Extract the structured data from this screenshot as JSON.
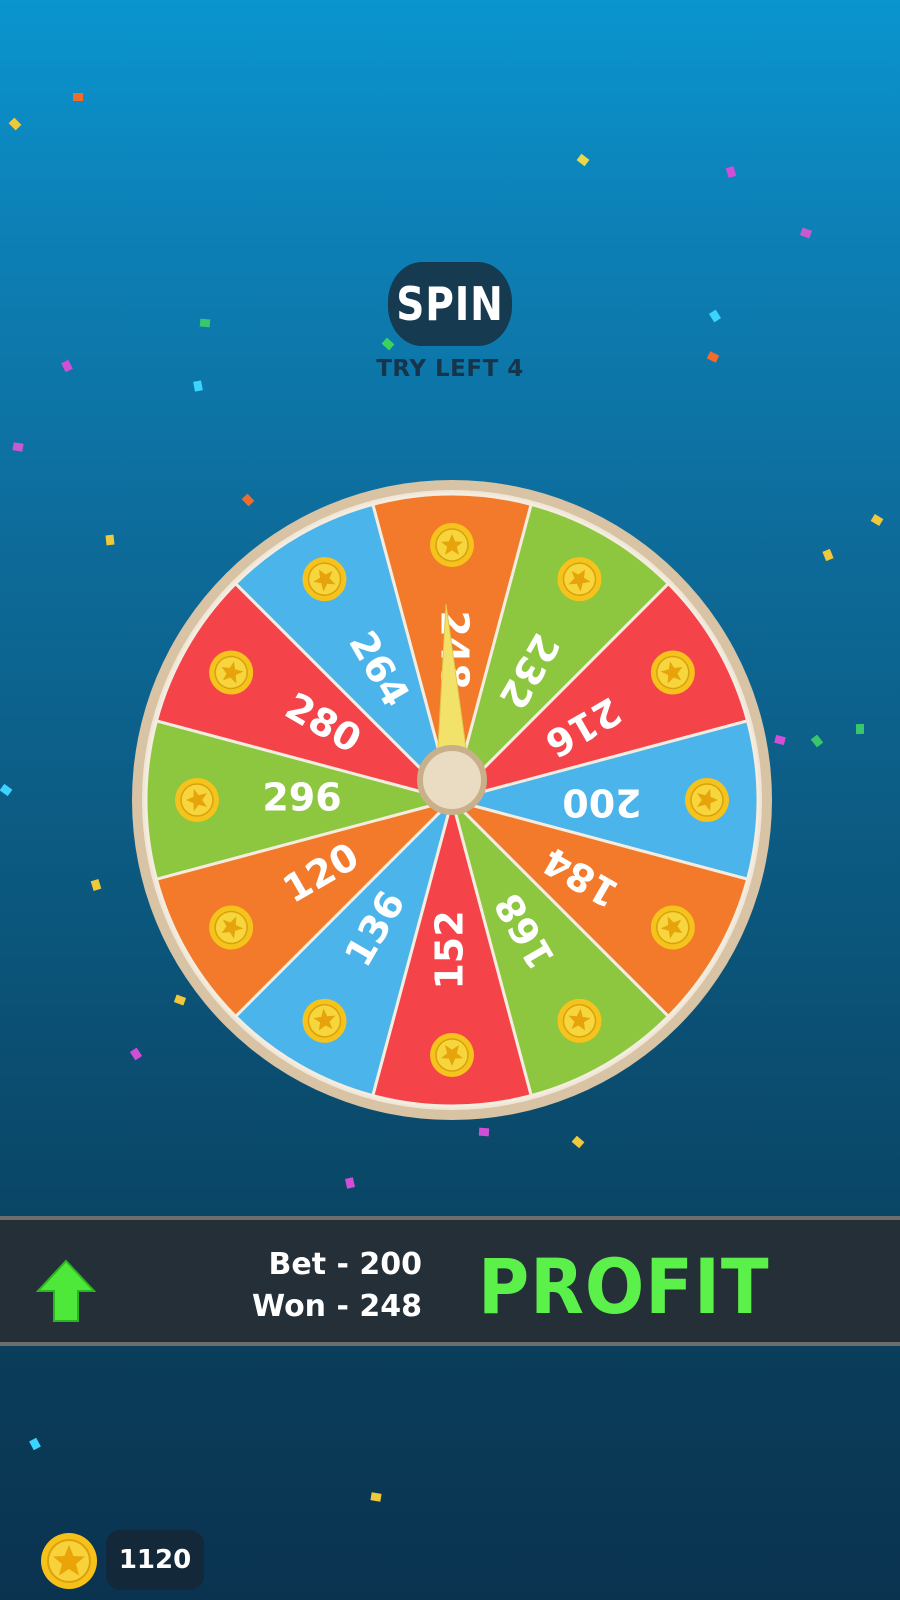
{
  "spin": {
    "label": "SPIN",
    "tries": "TRY LEFT 4"
  },
  "wheel": {
    "segments": [
      {
        "value": "248",
        "color": "#f27a2a"
      },
      {
        "value": "232",
        "color": "#8dc63f"
      },
      {
        "value": "216",
        "color": "#f4444a"
      },
      {
        "value": "200",
        "color": "#4bb4ea"
      },
      {
        "value": "184",
        "color": "#f27a2a"
      },
      {
        "value": "168",
        "color": "#8dc63f"
      },
      {
        "value": "152",
        "color": "#f4444a"
      },
      {
        "value": "136",
        "color": "#4bb4ea"
      },
      {
        "value": "120",
        "color": "#f27a2a"
      },
      {
        "value": "296",
        "color": "#8dc63f"
      },
      {
        "value": "280",
        "color": "#f4444a"
      },
      {
        "value": "264",
        "color": "#4bb4ea"
      }
    ],
    "rim_color": "#d8c3a4",
    "pointer_color": "#f3e26a"
  },
  "result": {
    "bet": "Bet - 200",
    "won": "Won - 248",
    "status": "PROFIT",
    "status_color": "#5cf04a",
    "icon": "up-arrow-icon"
  },
  "wallet": {
    "coins": "1120",
    "icon": "coin-icon"
  }
}
